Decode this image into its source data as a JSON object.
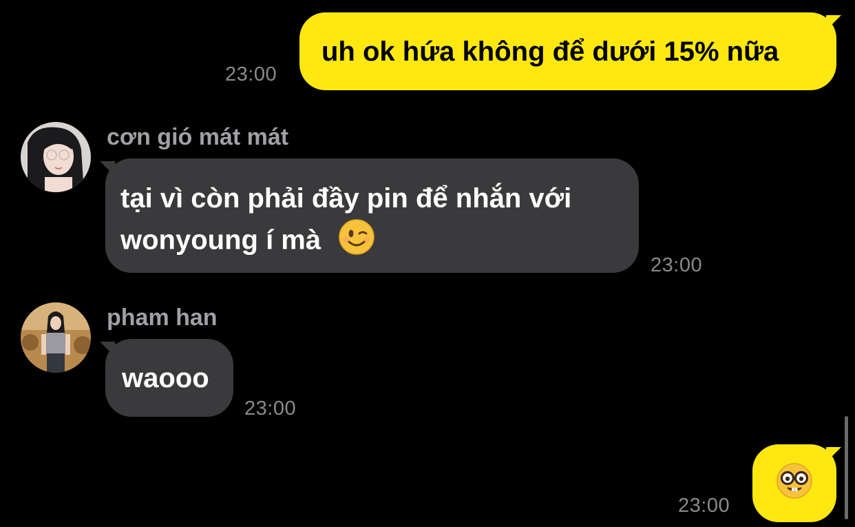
{
  "messages": [
    {
      "direction": "outgoing",
      "text": "uh ok hứa không để dưới 15% nữa",
      "time": "23:00"
    },
    {
      "direction": "incoming",
      "sender": "cơn gió mát mát",
      "avatar_icon": "profile-photo-girl-glasses",
      "line1": "tại vì còn phải đầy pin để nhắn với",
      "line2": "wonyoung í mà",
      "emoji": "winking-face-emoji",
      "time": "23:00"
    },
    {
      "direction": "incoming",
      "sender": "pham han",
      "avatar_icon": "profile-photo-girl-standing",
      "text": "waooo",
      "time": "23:00"
    },
    {
      "direction": "outgoing",
      "emoji": "nerd-face-emoji",
      "time": "23:00"
    }
  ],
  "colors": {
    "background": "#000000",
    "outgoing_bubble": "#ffe812",
    "incoming_bubble": "#3a3a3c",
    "timestamp": "#8a8a8e",
    "sender_name": "#a0a0a5"
  }
}
